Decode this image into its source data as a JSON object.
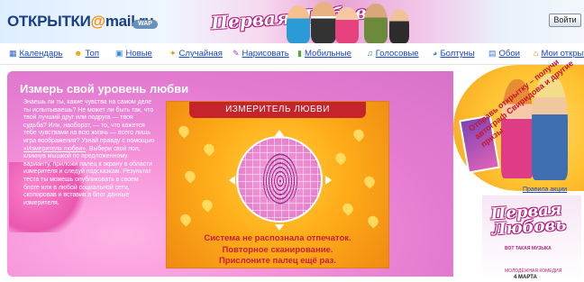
{
  "header": {
    "logo_text": "ОТКРЫТКИ",
    "logo_at": "@",
    "logo_domain": "mail.ru",
    "logo_mark": "®",
    "wap_badge": "WAP",
    "banner_title": "Первая Любовь",
    "login_label": "Войти"
  },
  "nav": {
    "items": [
      {
        "label": "Календарь",
        "icon": "calendar-icon"
      },
      {
        "label": "Топ",
        "icon": "smiley-icon"
      },
      {
        "label": "Новые",
        "icon": "new-icon"
      },
      {
        "label": "Случайная",
        "icon": "random-icon"
      },
      {
        "label": "Нарисовать",
        "icon": "draw-icon"
      },
      {
        "label": "Мобильные",
        "icon": "mobile-icon"
      },
      {
        "label": "Голосовые",
        "icon": "voice-icon"
      },
      {
        "label": "Болтуны",
        "icon": "talker-icon"
      },
      {
        "label": "Обои",
        "icon": "wallpaper-icon"
      },
      {
        "label": "Мои открыт",
        "icon": "home-icon"
      }
    ]
  },
  "main": {
    "title": "Измерь свой уровень любви",
    "description_1": "Знаешь ли ты, какие чувства на самом деле ты испытываешь? Не может ли быть так, что твой лучший друг или подруга — твоя судьба? Или, наоборот, — то, что кажется тебе чувствами на всю жизнь — всего лишь игра воображения? Узнай правду с помощью ",
    "description_link": "«Измерителя любви»",
    "description_2": ". Выбери свой пол, кликнув мышкой по предложенному варианту, приложи палец к экрану в области измерителя и следуй подсказкам. Результат теста ты можешь опубликовать в своем блоге или в любой социальной сети, скопировав и вставив в блог данные измерителя."
  },
  "meter": {
    "header": "ИЗМЕРИТЕЛЬ ЛЮБВИ",
    "message_line1": "Система не распознала отпечаток.",
    "message_line2": "Повторное сканирование.",
    "message_line3": "Прислоните палец ещё раз."
  },
  "promo": {
    "circle_text": "Отправь открытку – получи автограф Свиридова и другие призы",
    "rules_link": "Правила акции",
    "ad_title": "Первая Любовь",
    "ad_tagline": "ВОТ ТАКАЯ МУЗЫКА",
    "ad_caption": "МОЛОДЁЖНАЯ КОМЕДИЯ",
    "ad_date": "4 МАРТА"
  }
}
